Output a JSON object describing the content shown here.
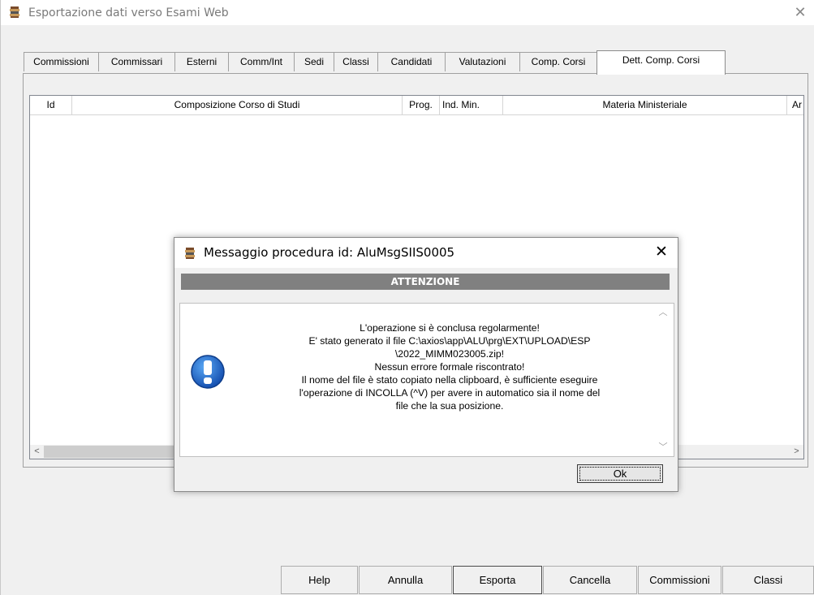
{
  "window": {
    "title": "Esportazione dati verso Esami Web",
    "close_glyph": "✕"
  },
  "tabs": [
    {
      "label": "Commissioni"
    },
    {
      "label": "Commissari"
    },
    {
      "label": "Esterni"
    },
    {
      "label": "Comm/Int"
    },
    {
      "label": "Sedi"
    },
    {
      "label": "Classi"
    },
    {
      "label": "Candidati"
    },
    {
      "label": "Valutazioni"
    },
    {
      "label": "Comp. Corsi"
    },
    {
      "label": "Dett. Comp. Corsi",
      "active": true
    }
  ],
  "listview": {
    "columns": [
      "Id",
      "Composizione Corso di Studi",
      "Prog.",
      "Ind. Min.",
      "Materia Ministeriale",
      "Ar"
    ],
    "rows": [],
    "scroll_left": "<",
    "scroll_right": ">"
  },
  "buttons": {
    "help": "Help",
    "annulla": "Annulla",
    "esporta": "Esporta",
    "cancella": "Cancella",
    "commissioni": "Commissioni",
    "classi": "Classi"
  },
  "dialog": {
    "title": "Messaggio procedura id: AluMsgSIIS0005",
    "close_glyph": "✕",
    "header": "ATTENZIONE",
    "message_lines": [
      "L'operazione si è conclusa regolarmente!",
      "E' stato generato il file C:\\axios\\app\\ALU\\prg\\EXT\\UPLOAD\\ESP",
      "\\2022_MIMM023005.zip!",
      "Nessun errore formale riscontrato!",
      "Il nome del file è stato copiato nella clipboard, è sufficiente eseguire",
      "l'operazione di INCOLLA (^V) per avere in automatico sia il nome del",
      "file che la sua posizione."
    ],
    "icon": "exclamation-icon",
    "ok_label": "Ok"
  },
  "colors": {
    "info_blue": "#1f6fd0",
    "header_gray": "#808080"
  }
}
